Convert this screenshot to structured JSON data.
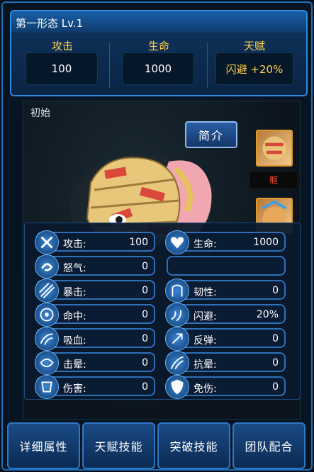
{
  "form": {
    "title": "第一形态 Lv.1",
    "attack_label": "攻击",
    "attack_value": "100",
    "life_label": "生命",
    "life_value": "1000",
    "talent_label": "天赋",
    "talent_value": "闪避 +20%"
  },
  "stage_label": "初始",
  "intro_button": "简介",
  "side": {
    "thumb_label": "躯"
  },
  "stats": {
    "left": [
      {
        "label": "攻击:",
        "value": "100",
        "icon": "crossed-swords-icon"
      },
      {
        "label": "怒气:",
        "value": "0",
        "icon": "rage-swirl-icon"
      },
      {
        "label": "暴击:",
        "value": "0",
        "icon": "critical-slash-icon"
      },
      {
        "label": "命中:",
        "value": "0",
        "icon": "target-icon"
      },
      {
        "label": "吸血:",
        "value": "0",
        "icon": "lifesteal-icon"
      },
      {
        "label": "击晕:",
        "value": "0",
        "icon": "stun-icon"
      },
      {
        "label": "伤害:",
        "value": "0",
        "icon": "damage-icon"
      }
    ],
    "right": [
      {
        "label": "生命:",
        "value": "1000",
        "icon": "heart-icon"
      },
      {
        "label": "",
        "value": "",
        "icon": ""
      },
      {
        "label": "韧性:",
        "value": "0",
        "icon": "toughness-icon"
      },
      {
        "label": "闪避:",
        "value": "20%",
        "icon": "dodge-icon"
      },
      {
        "label": "反弹:",
        "value": "0",
        "icon": "reflect-icon"
      },
      {
        "label": "抗晕:",
        "value": "0",
        "icon": "stun-resist-icon"
      },
      {
        "label": "免伤:",
        "value": "0",
        "icon": "shield-icon"
      }
    ]
  },
  "tabs": [
    "详细属性",
    "天赋技能",
    "突破技能",
    "团队配合"
  ],
  "colors": {
    "accent": "#ffd24a",
    "border": "#2e6fb8",
    "panel": "#0a1c33"
  }
}
